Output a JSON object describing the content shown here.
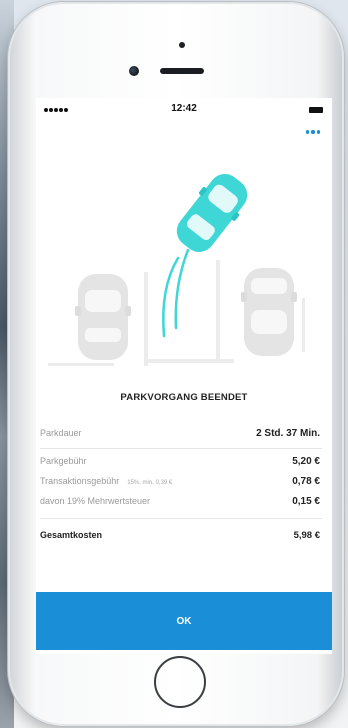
{
  "status_bar": {
    "time": "12:42"
  },
  "header": {
    "more_icon": "more-horizontal-icon"
  },
  "illustration": {
    "icon": "car-leaving-parking-spot-icon",
    "accent_color": "#3fd6d6"
  },
  "summary": {
    "title": "PARKVORGANG BEENDET",
    "duration_label": "Parkdauer",
    "duration_value": "2 Std. 37 Min.",
    "parking_fee_label": "Parkgebühr",
    "parking_fee_value": "5,20 €",
    "transaction_fee_label": "Transaktionsgebühr",
    "transaction_fee_note": "15%, min. 0,39 €",
    "transaction_fee_value": "0,78 €",
    "vat_label": "davon 19% Mehrwertsteuer",
    "vat_value": "0,15 €",
    "total_label": "Gesamtkosten",
    "total_value": "5,98 €"
  },
  "actions": {
    "ok_label": "OK"
  },
  "colors": {
    "primary": "#1a8fd8",
    "accent": "#3fd6d6",
    "muted_text": "#9a9a9a"
  }
}
